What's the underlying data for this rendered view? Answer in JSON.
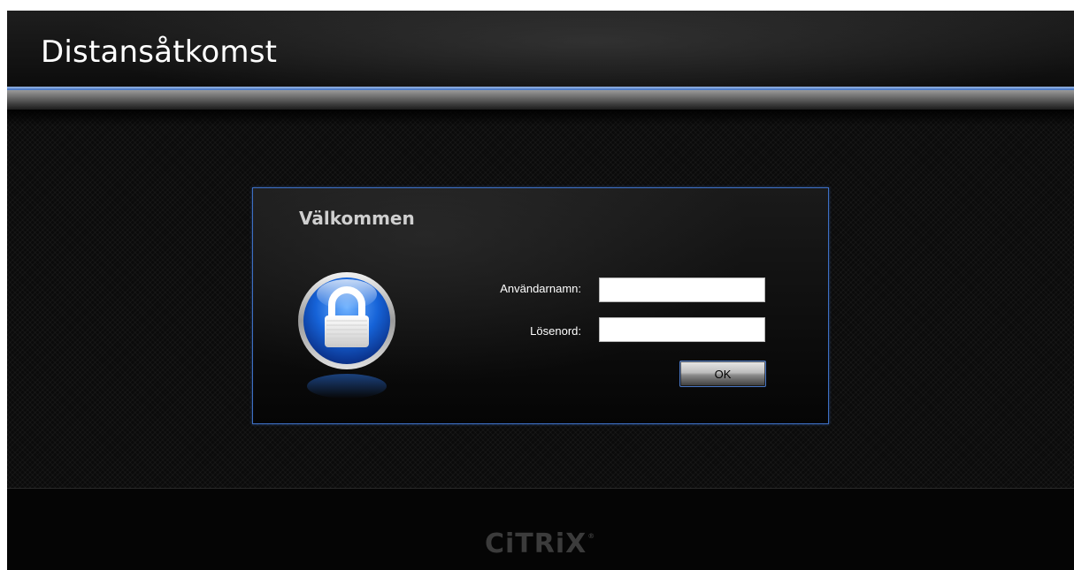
{
  "header": {
    "title": "Distansåtkomst"
  },
  "dialog": {
    "title": "Välkommen",
    "username_label": "Användarnamn:",
    "username_value": "",
    "password_label": "Lösenord:",
    "password_value": "",
    "ok_label": "OK"
  },
  "footer": {
    "logo_text": "CiTRiX",
    "logo_mark": "®"
  },
  "icons": {
    "lock": "lock-icon"
  },
  "colors": {
    "accent_blue": "#3d6fc4",
    "background": "#0b0b0b",
    "title_text": "#ffffff",
    "dialog_title": "#cfcfcf"
  }
}
